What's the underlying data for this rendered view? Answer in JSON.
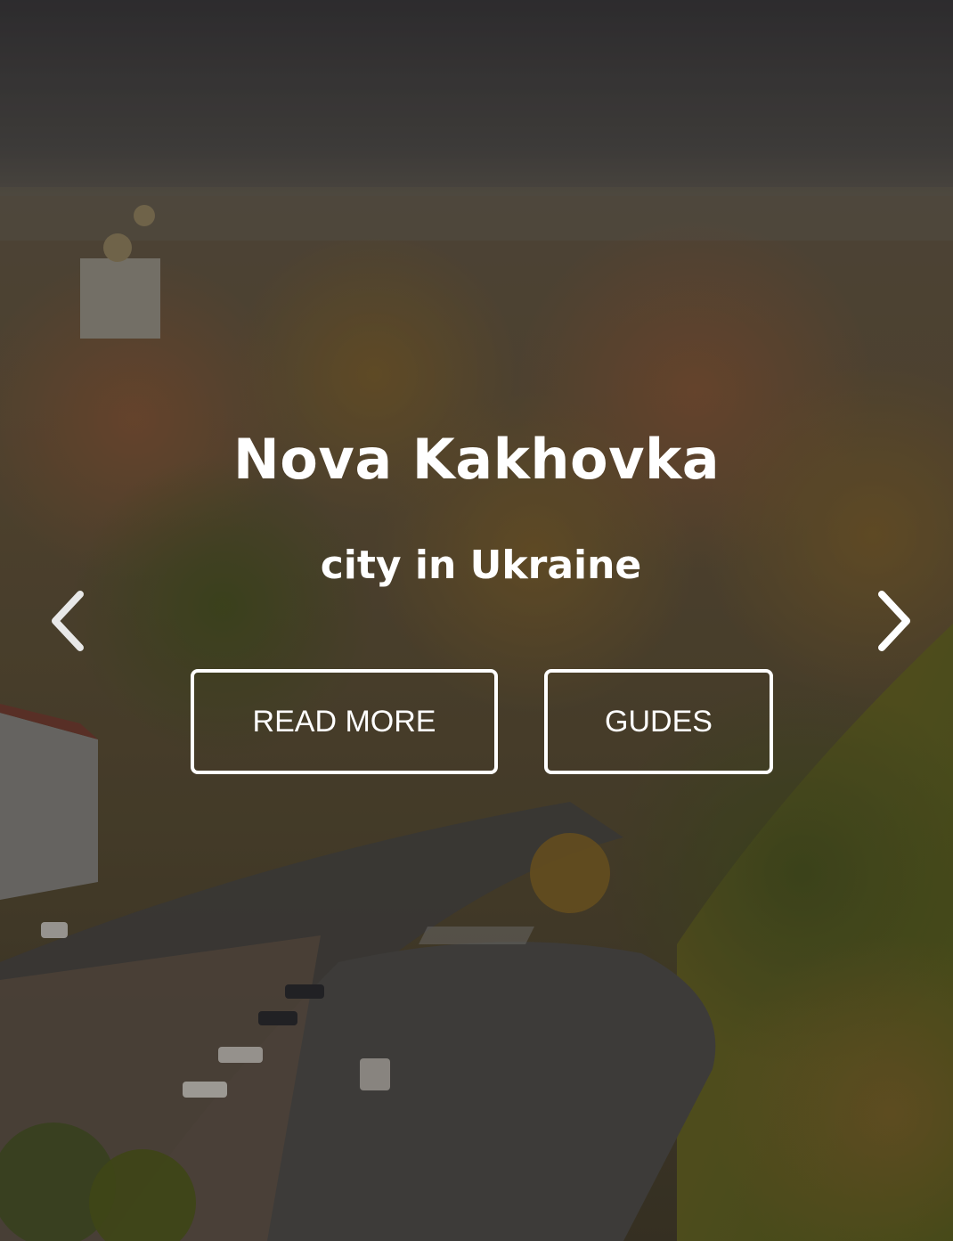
{
  "hero": {
    "title": "Nova Kakhovka",
    "subtitle": "city in Ukraine",
    "background_image": "aerial-city-photo"
  },
  "buttons": {
    "read_more_label": "READ MORE",
    "guides_label": "GUDES"
  },
  "carousel": {
    "prev_icon": "chevron-left-icon",
    "next_icon": "chevron-right-icon"
  },
  "colors": {
    "text": "#ffffff",
    "button_border": "#ffffff",
    "overlay": "rgba(0,0,0,0.28)"
  }
}
